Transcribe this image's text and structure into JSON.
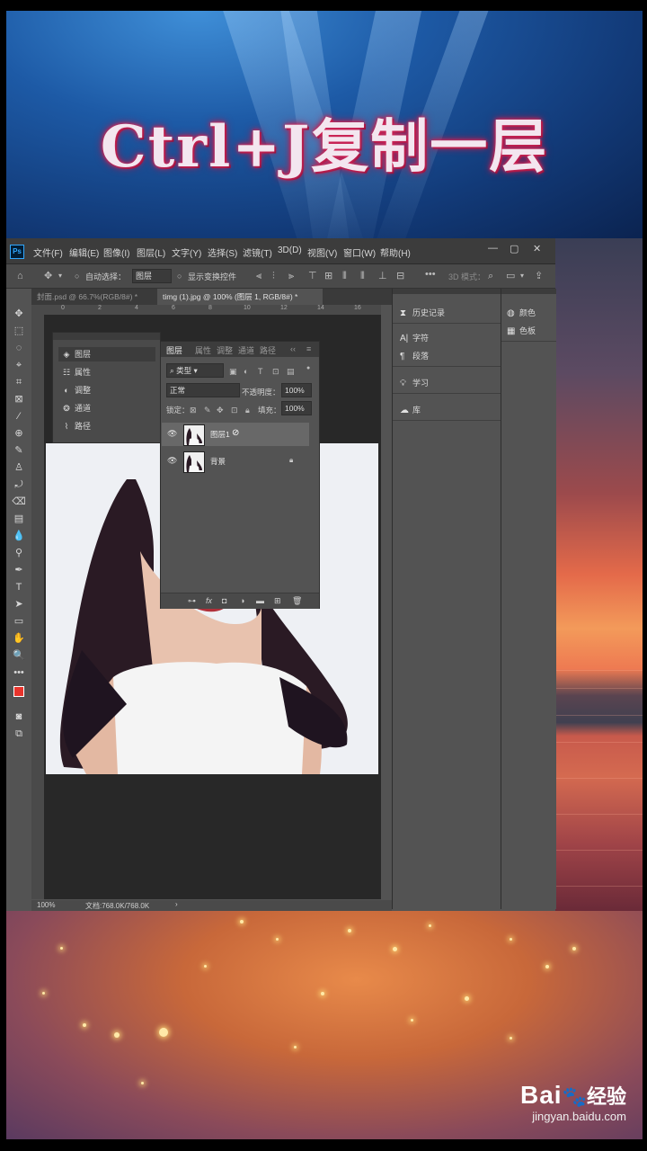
{
  "banner": {
    "title": "Ctrl+J复制一层"
  },
  "watermark": {
    "logo": "Bai",
    "logo2": "经验",
    "url": "jingyan.baidu.com"
  },
  "photoshop": {
    "logo": "Ps",
    "menu": [
      "文件(F)",
      "编辑(E)",
      "图像(I)",
      "图层(L)",
      "文字(Y)",
      "选择(S)",
      "滤镜(T)",
      "3D(D)",
      "视图(V)",
      "窗口(W)",
      "帮助(H)"
    ],
    "window_buttons": [
      "—",
      "▢",
      "✕"
    ],
    "options": {
      "auto_select_label": "自动选择：",
      "auto_select_value": "图层",
      "show_transform_label": "显示变换控件",
      "mode_3d": "3D 模式："
    },
    "tabs": [
      {
        "label": "封面.psd @ 66.7%(RGB/8#) *"
      },
      {
        "label": "timg (1).jpg @ 100% (图层 1, RGB/8#) *"
      }
    ],
    "ruler_numbers": [
      "0",
      "2",
      "4",
      "6",
      "8",
      "10",
      "12",
      "14",
      "16"
    ],
    "status": {
      "zoom": "100%",
      "doc": "文档:768.0K/768.0K"
    },
    "panels_col1": [
      {
        "icon": "history-icon",
        "label": "历史记录"
      },
      {
        "icon": "character-icon",
        "label": "字符"
      },
      {
        "icon": "paragraph-icon",
        "label": "段落"
      },
      {
        "icon": "learn-icon",
        "label": "学习"
      },
      {
        "icon": "library-icon",
        "label": "库"
      }
    ],
    "panels_col2": [
      {
        "icon": "color-icon",
        "label": "颜色"
      },
      {
        "icon": "swatches-icon",
        "label": "色板"
      }
    ],
    "mini_panel": [
      {
        "label": "图层",
        "active": true
      },
      {
        "label": "属性",
        "active": false
      },
      {
        "label": "调整",
        "active": false
      },
      {
        "label": "通道",
        "active": false
      },
      {
        "label": "路径",
        "active": false
      }
    ],
    "layers_panel": {
      "tabs": [
        "图层",
        "属性",
        "调整",
        "通道",
        "路径"
      ],
      "filter": "类型",
      "blend_mode": "正常",
      "opacity_label": "不透明度：",
      "opacity": "100%",
      "lock_label": "锁定：",
      "fill_label": "填充：",
      "fill": "100%",
      "layers": [
        {
          "name": "图层1",
          "selected": true
        },
        {
          "name": "背景",
          "selected": false
        }
      ]
    }
  }
}
